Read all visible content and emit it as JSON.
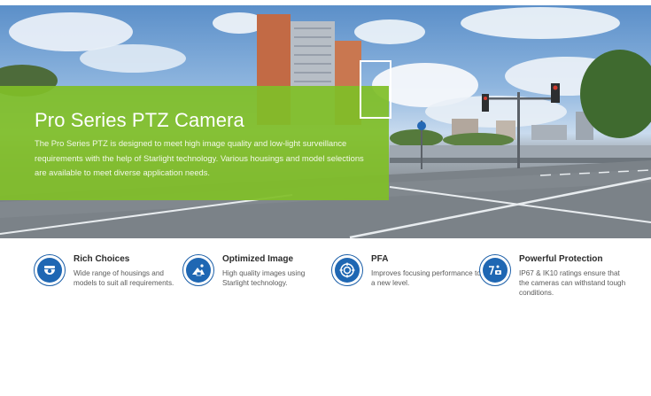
{
  "hero": {
    "title": "Pro Series PTZ Camera",
    "description": "The Pro Series PTZ is designed to meet high image quality and low-light surveillance requirements with the help of Starlight technology. Various housings and model selections are available to meet diverse application needs.",
    "banner_color": "#80be28"
  },
  "features": [
    {
      "icon": "camera-dome-icon",
      "title": "Rich Choices",
      "description": "Wide range of housings and models to suit all requirements."
    },
    {
      "icon": "image-quality-icon",
      "title": "Optimized Image",
      "description": "High quality images using Starlight technology."
    },
    {
      "icon": "focus-target-icon",
      "title": "PFA",
      "description": "Improves focusing performance to a new level."
    },
    {
      "icon": "protection-shield-icon",
      "title": "Powerful Protection",
      "description": "IP67 & IK10 ratings ensure that the cameras can withstand tough conditions."
    }
  ],
  "accent_color": "#1f67b3"
}
